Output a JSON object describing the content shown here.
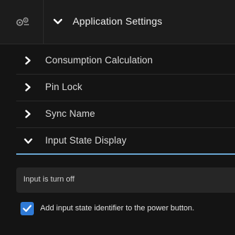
{
  "header": {
    "title": "Application Settings",
    "settings_icon": "settings-icon",
    "toggle_icon": "chevron-down-icon"
  },
  "sections": [
    {
      "label": "Consumption Calculation",
      "icon": "chevron-right-icon",
      "expanded": false
    },
    {
      "label": "Pin Lock",
      "icon": "chevron-right-icon",
      "expanded": false
    },
    {
      "label": "Sync Name",
      "icon": "chevron-right-icon",
      "expanded": false
    },
    {
      "label": "Input State Display",
      "icon": "chevron-down-icon",
      "expanded": true
    }
  ],
  "input_state": {
    "status_text": "Input is turn off",
    "checkbox_label": "Add input state identifier to the power button.",
    "checkbox_checked": true
  },
  "colors": {
    "background": "#141414",
    "header_background": "#1c1c1c",
    "accent": "#6aa7d4",
    "checkbox": "#2f7ad6",
    "status_box": "#262626"
  }
}
